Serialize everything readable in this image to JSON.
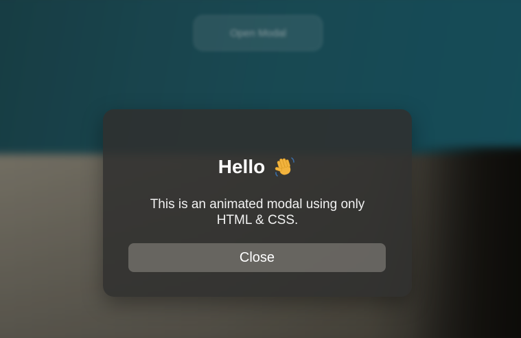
{
  "background": {
    "open_button_label": "Open Modal"
  },
  "modal": {
    "title": "Hello",
    "title_icon": "waving-hand-icon",
    "message": "This is an animated modal using only HTML & CSS.",
    "close_label": "Close"
  },
  "colors": {
    "modal_background": "#30302e",
    "button_background": "#78766f",
    "text": "#ffffff"
  }
}
